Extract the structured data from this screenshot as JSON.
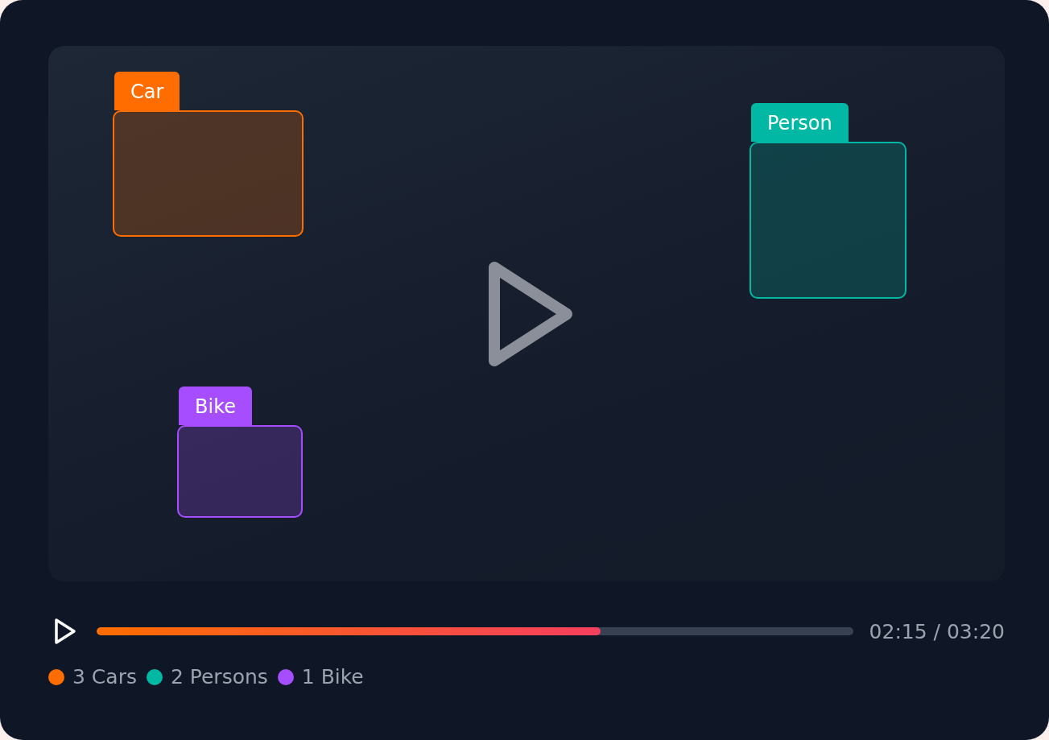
{
  "detections": [
    {
      "label": "Car",
      "color": "#ff6d00"
    },
    {
      "label": "Person",
      "color": "#00b8a3"
    },
    {
      "label": "Bike",
      "color": "#a64dff"
    }
  ],
  "progress": {
    "level": 0.666,
    "time": "02:15 / 03:20"
  },
  "legend": [
    {
      "text": "3 Cars",
      "color": "#ff6d00"
    },
    {
      "text": "2 Persons",
      "color": "#00b8a3"
    },
    {
      "text": "1 Bike",
      "color": "#a64dff"
    }
  ]
}
